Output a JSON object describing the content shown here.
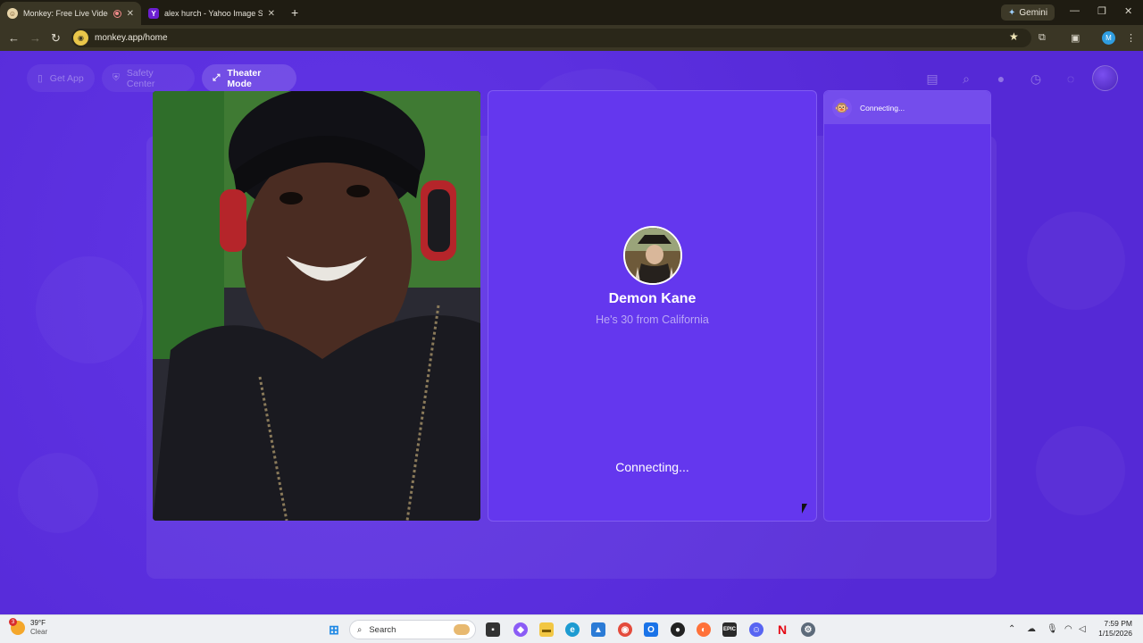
{
  "browser": {
    "tabs": [
      {
        "title": "Monkey: Free Live Video Ch",
        "active": true
      },
      {
        "title": "alex hurch - Yahoo Image Searc",
        "active": false
      }
    ],
    "new_tab_label": "+",
    "gemini_label": "Gemini",
    "url": "monkey.app/home",
    "profile_initial": "M"
  },
  "page": {
    "nav": {
      "get_app": "Get App",
      "safety_center": "Safety Center",
      "theater_mode": "Theater Mode"
    },
    "match": {
      "name": "Demon Kane",
      "subtitle": "He's 30 from California",
      "status": "Connecting..."
    },
    "side_panel": {
      "status": "Connecting..."
    },
    "colors": {
      "background": "#5b2fe0",
      "panel": "#6437ee",
      "accent_text": "#b9a6f5"
    }
  },
  "taskbar": {
    "weather": {
      "temp": "39°F",
      "condition": "Clear",
      "badge": "3"
    },
    "search_placeholder": "Search",
    "time": "7:59 PM",
    "date": "1/15/2026"
  }
}
